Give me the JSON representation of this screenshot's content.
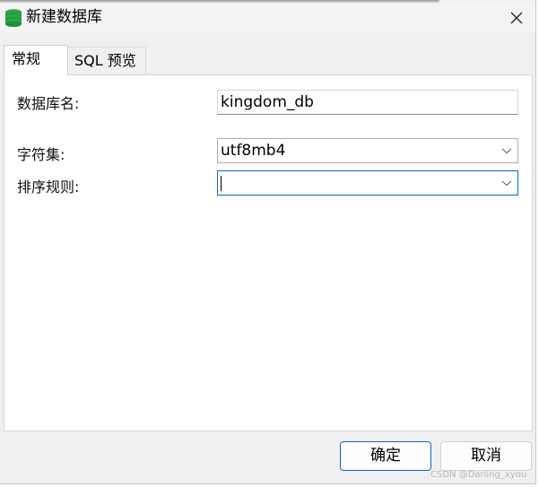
{
  "window": {
    "title": "新建数据库",
    "icon": "database-icon",
    "close_icon": "close-icon"
  },
  "tabs": [
    {
      "label": "常规",
      "active": true
    },
    {
      "label": "SQL 预览",
      "active": false
    }
  ],
  "form": {
    "db_name_label": "数据库名:",
    "db_name_value": "kingdom_db",
    "charset_label": "字符集:",
    "charset_value": "utf8mb4",
    "collation_label": "排序规则:",
    "collation_value": ""
  },
  "buttons": {
    "ok_label": "确定",
    "cancel_label": "取消"
  },
  "watermark": "CSDN @Darling_xyou",
  "colors": {
    "accent": "#0a64c8",
    "db_icon_green": "#2aa84a"
  }
}
